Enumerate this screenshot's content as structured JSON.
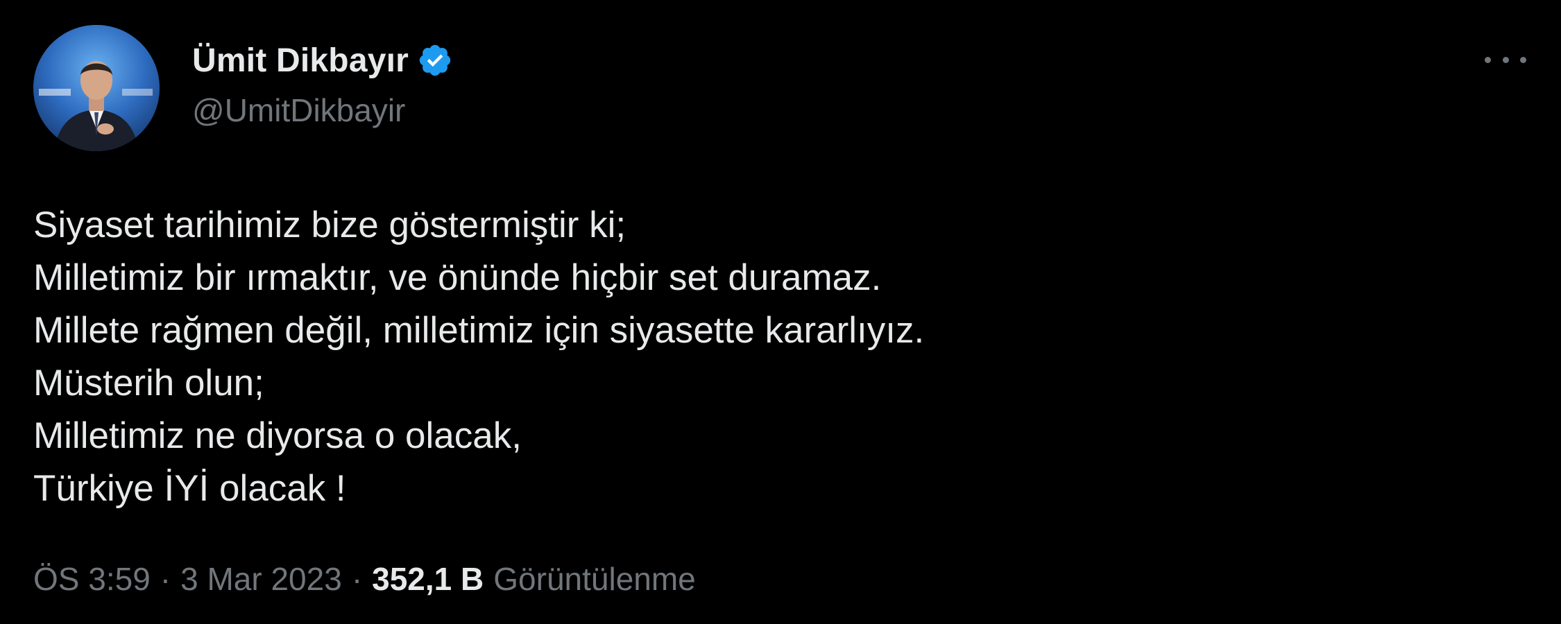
{
  "author": {
    "display_name": "Ümit Dikbayır",
    "handle": "@UmitDikbayir",
    "verified": true,
    "verified_color": "#1d9bf0"
  },
  "menu": {
    "icon": "more-horizontal-icon"
  },
  "tweet": {
    "lines": [
      "Siyaset tarihimiz bize göstermiştir ki;",
      "Milletimiz bir ırmaktır, ve önünde hiçbir set duramaz.",
      "Millete rağmen değil, milletimiz için siyasette kararlıyız.",
      "Müsterih olun;",
      "Milletimiz ne diyorsa o olacak,",
      "Türkiye İYİ olacak !"
    ]
  },
  "meta": {
    "time": "ÖS 3:59",
    "separator": "·",
    "date": "3 Mar 2023",
    "views_count": "352,1 B",
    "views_label": "Görüntülenme"
  },
  "colors": {
    "background": "#000000",
    "text_primary": "#e7e9ea",
    "text_secondary": "#71767b",
    "accent": "#1d9bf0"
  }
}
